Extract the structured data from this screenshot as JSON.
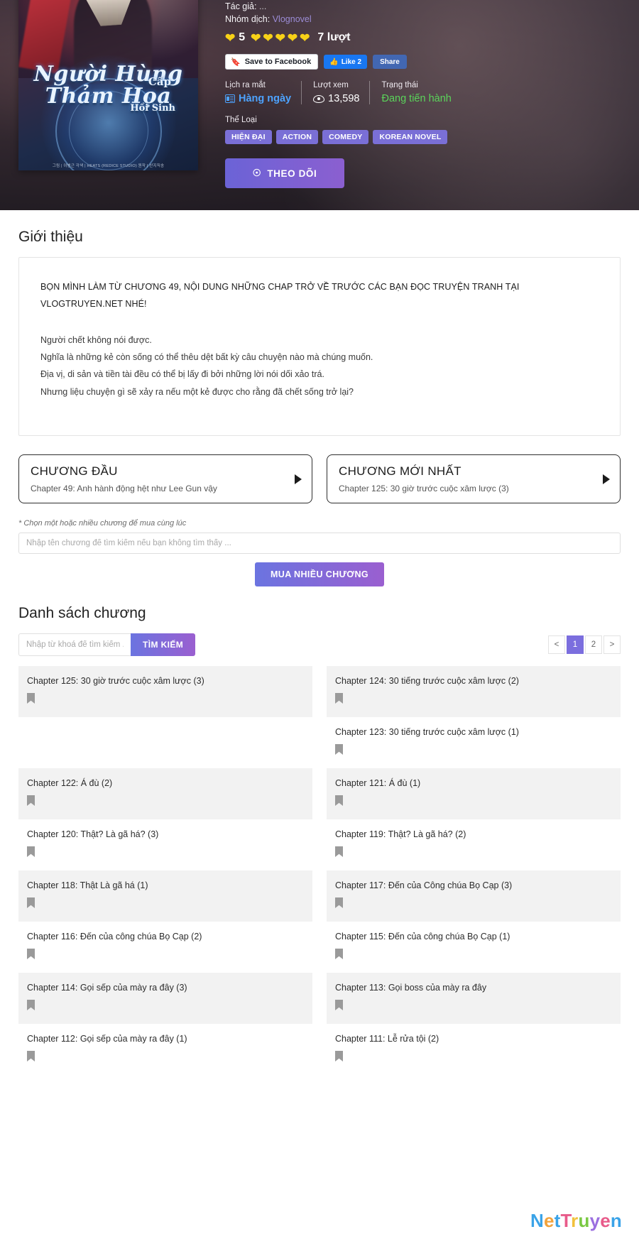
{
  "hero": {
    "cover": {
      "title_line1": "Người Hùng",
      "title_line2": "Thảm Họa",
      "title_small1": "Cấp",
      "title_small2": "Hồi Sinh",
      "credits": "그림 | 이범근    각색 | HEATS (REDICE STUDIO)    원작 | 산지직송"
    },
    "author_label": "Tác giả:",
    "author_value": "...",
    "group_label": "Nhóm dịch:",
    "group_value": "Vlognovel",
    "rating_score": "5",
    "rating_votes": "7 lượt",
    "hearts_before": 1,
    "hearts_after": 5,
    "facebook": {
      "save_label": "Save to Facebook",
      "like_label": "Like 2",
      "share_label": "Share"
    },
    "stats": [
      {
        "caption": "Lịch ra mắt",
        "value": "Hàng ngày",
        "icon": "calendar-icon",
        "color": "#4da3ff"
      },
      {
        "caption": "Lượt xem",
        "value": "13,598",
        "icon": "eye-icon",
        "color": "#ffffff"
      },
      {
        "caption": "Trạng thái",
        "value": "Đang tiến hành",
        "icon": "",
        "color": "#5ad45a"
      }
    ],
    "genre_caption": "Thể Loại",
    "genres": [
      "HIỆN ĐẠI",
      "ACTION",
      "COMEDY",
      "KOREAN NOVEL"
    ],
    "follow_button": "THEO DÕI",
    "follow_icon": "bell-icon",
    "accent_color": "#7a6fd6"
  },
  "intro": {
    "heading": "Giới thiệu",
    "notice": "BỌN MÌNH LÀM TỪ CHƯƠNG 49, NỘI DUNG NHỮNG CHAP TRỞ VỀ TRƯỚC CÁC BẠN ĐỌC TRUYỆN TRANH TẠI VLOGTRUYEN.NET NHÉ!",
    "body_lines": [
      "Người chết không nói được.",
      "Nghĩa là những kẻ còn sống có thể thêu dệt bất kỳ câu chuyện nào mà chúng muốn.",
      "Địa vị, di sản và tiền tài đều có thể bị lấy đi bởi những lời nói dối xảo trá.",
      "Nhưng liệu chuyện gì sẽ xảy ra nếu một kẻ được cho rằng đã chết sống trở lại?"
    ]
  },
  "chapter_nav": {
    "first": {
      "title": "CHƯƠNG ĐẦU",
      "subtitle": "Chapter 49: Anh hành động hệt như Lee Gun vậy"
    },
    "latest": {
      "title": "CHƯƠNG MỚI NHẤT",
      "subtitle": "Chapter 125: 30 giờ trước cuộc xâm lược (3)"
    }
  },
  "buy": {
    "note": "* Chọn một hoặc nhiều chương để mua cùng lúc",
    "input_placeholder": "Nhập tên chương để tìm kiếm nếu bạn không tìm thấy ...",
    "input_value": "",
    "button_label": "MUA NHIỀU CHƯƠNG"
  },
  "chapter_list": {
    "heading": "Danh sách chương",
    "search_placeholder": "Nhập từ khoá để tìm kiếm ...",
    "search_value": "",
    "search_button": "TÌM KIẾM",
    "pagination": {
      "prev": "<",
      "pages": [
        "1",
        "2"
      ],
      "current": "1",
      "next": ">"
    },
    "columns": [
      [
        {
          "label": "Chapter 125: 30 giờ trước cuộc xâm lược (3)",
          "shaded": true
        },
        {
          "label": "",
          "shaded": false,
          "empty": true
        },
        {
          "label": "Chapter 122: Á đù (2)",
          "shaded": true
        },
        {
          "label": "Chapter 120: Thật? Là gã há? (3)",
          "shaded": false
        },
        {
          "label": "Chapter 118: Thật Là gã há (1)",
          "shaded": true
        },
        {
          "label": "Chapter 116: Đến của công chúa Bọ Cạp (2)",
          "shaded": false
        },
        {
          "label": "Chapter 114: Gọi sếp của mày ra đây (3)",
          "shaded": true
        },
        {
          "label": "Chapter 112: Gọi sếp của mày ra đây (1)",
          "shaded": false
        }
      ],
      [
        {
          "label": "Chapter 124: 30 tiếng trước cuộc xâm lược (2)",
          "shaded": true
        },
        {
          "label": "Chapter 123: 30 tiếng trước cuộc xâm lược (1)",
          "shaded": false
        },
        {
          "label": "Chapter 121: Á đù (1)",
          "shaded": true
        },
        {
          "label": "Chapter 119: Thật? Là gã há? (2)",
          "shaded": false
        },
        {
          "label": "Chapter 117: Đến của Công chúa Bọ Cạp (3)",
          "shaded": true
        },
        {
          "label": "Chapter 115: Đến của công chúa Bọ Cạp (1)",
          "shaded": false
        },
        {
          "label": "Chapter 113: Gọi boss của mày ra đây",
          "shaded": true
        },
        {
          "label": "Chapter 111: Lễ rửa tội (2)",
          "shaded": false
        }
      ]
    ]
  },
  "footer": {
    "logo": [
      {
        "ch": "N",
        "color": "#3aa3e8"
      },
      {
        "ch": "e",
        "color": "#f2a33c"
      },
      {
        "ch": "t",
        "color": "#3aa3e8"
      },
      {
        "ch": "T",
        "color": "#e85b8a"
      },
      {
        "ch": "r",
        "color": "#f2c13c"
      },
      {
        "ch": "u",
        "color": "#7ac943"
      },
      {
        "ch": "y",
        "color": "#9b6fe0"
      },
      {
        "ch": "e",
        "color": "#e85b8a"
      },
      {
        "ch": "n",
        "color": "#3aa3e8"
      }
    ]
  }
}
